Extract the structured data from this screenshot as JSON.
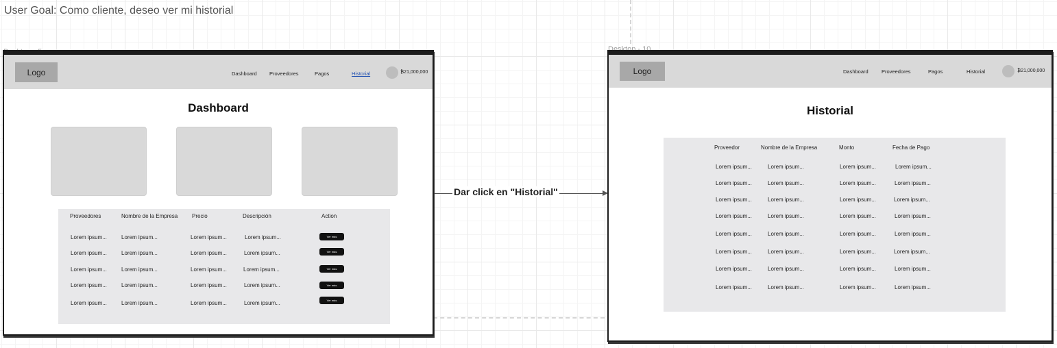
{
  "user_goal": "User Goal: Como cliente, deseo ver mi historial",
  "frames": {
    "left": {
      "label": "Desktop - 5",
      "logo": "Logo",
      "nav": [
        "Dashboard",
        "Proveedores",
        "Pagos",
        "Historial"
      ],
      "active_nav": "Historial",
      "balance": "₿21,000,000",
      "title": "Dashboard",
      "table": {
        "headers": [
          "Proveedores",
          "Nombre de la Empresa",
          "Precio",
          "Descripción",
          "Action"
        ],
        "rows": [
          [
            "Lorem ipsum...",
            "Lorem ipsum...",
            "Lorem ipsum...",
            "Lorem ipsum..."
          ],
          [
            "Lorem ipsum...",
            "Lorem ipsum...",
            "Lorem ipsum...",
            "Lorem ipsum..."
          ],
          [
            "Lorem ipsum...",
            "Lorem ipsum...",
            "Lorem ipsum...",
            "Lorem ipsum..."
          ],
          [
            "Lorem ipsum...",
            "Lorem ipsum...",
            "Lorem ipsum...",
            "Lorem ipsum..."
          ],
          [
            "Lorem ipsum...",
            "Lorem ipsum...",
            "Lorem ipsum...",
            "Lorem ipsum..."
          ]
        ],
        "button_label": "Ver más"
      }
    },
    "right": {
      "label": "Desktop - 10",
      "logo": "Logo",
      "nav": [
        "Dashboard",
        "Proveedores",
        "Pagos",
        "Historial"
      ],
      "balance": "₿21,000,000",
      "title": "Historial",
      "table": {
        "headers": [
          "Proveedor",
          "Nombre de la Empresa",
          "Monto",
          "Fecha de Pago"
        ],
        "rows": [
          [
            "Lorem ipsum...",
            "Lorem ipsum...",
            "Lorem ipsum...",
            "Lorem ipsum..."
          ],
          [
            "Lorem ipsum...",
            "Lorem ipsum...",
            "Lorem ipsum...",
            "Lorem ipsum..."
          ],
          [
            "Lorem ipsum...",
            "Lorem ipsum...",
            "Lorem ipsum...",
            "Lorem ipsum..."
          ],
          [
            "Lorem ipsum...",
            "Lorem ipsum...",
            "Lorem ipsum...",
            "Lorem ipsum..."
          ],
          [
            "Lorem ipsum...",
            "Lorem ipsum...",
            "Lorem ipsum...",
            "Lorem ipsum..."
          ],
          [
            "Lorem ipsum...",
            "Lorem ipsum...",
            "Lorem ipsum...",
            "Lorem ipsum..."
          ],
          [
            "Lorem ipsum...",
            "Lorem ipsum...",
            "Lorem ipsum...",
            "Lorem ipsum..."
          ],
          [
            "Lorem ipsum...",
            "Lorem ipsum...",
            "Lorem ipsum...",
            "Lorem ipsum..."
          ]
        ]
      }
    }
  },
  "transition": {
    "label": "Dar click en \"Historial\""
  },
  "colors": {
    "navbar": "#d9d9d9",
    "logo_box": "#a8a8a8",
    "card": "#d9d9d9",
    "table_bg": "#e8e8ea",
    "button": "#111111",
    "active_link": "#1f4fb0",
    "frame_border": "#1c1c1c"
  }
}
